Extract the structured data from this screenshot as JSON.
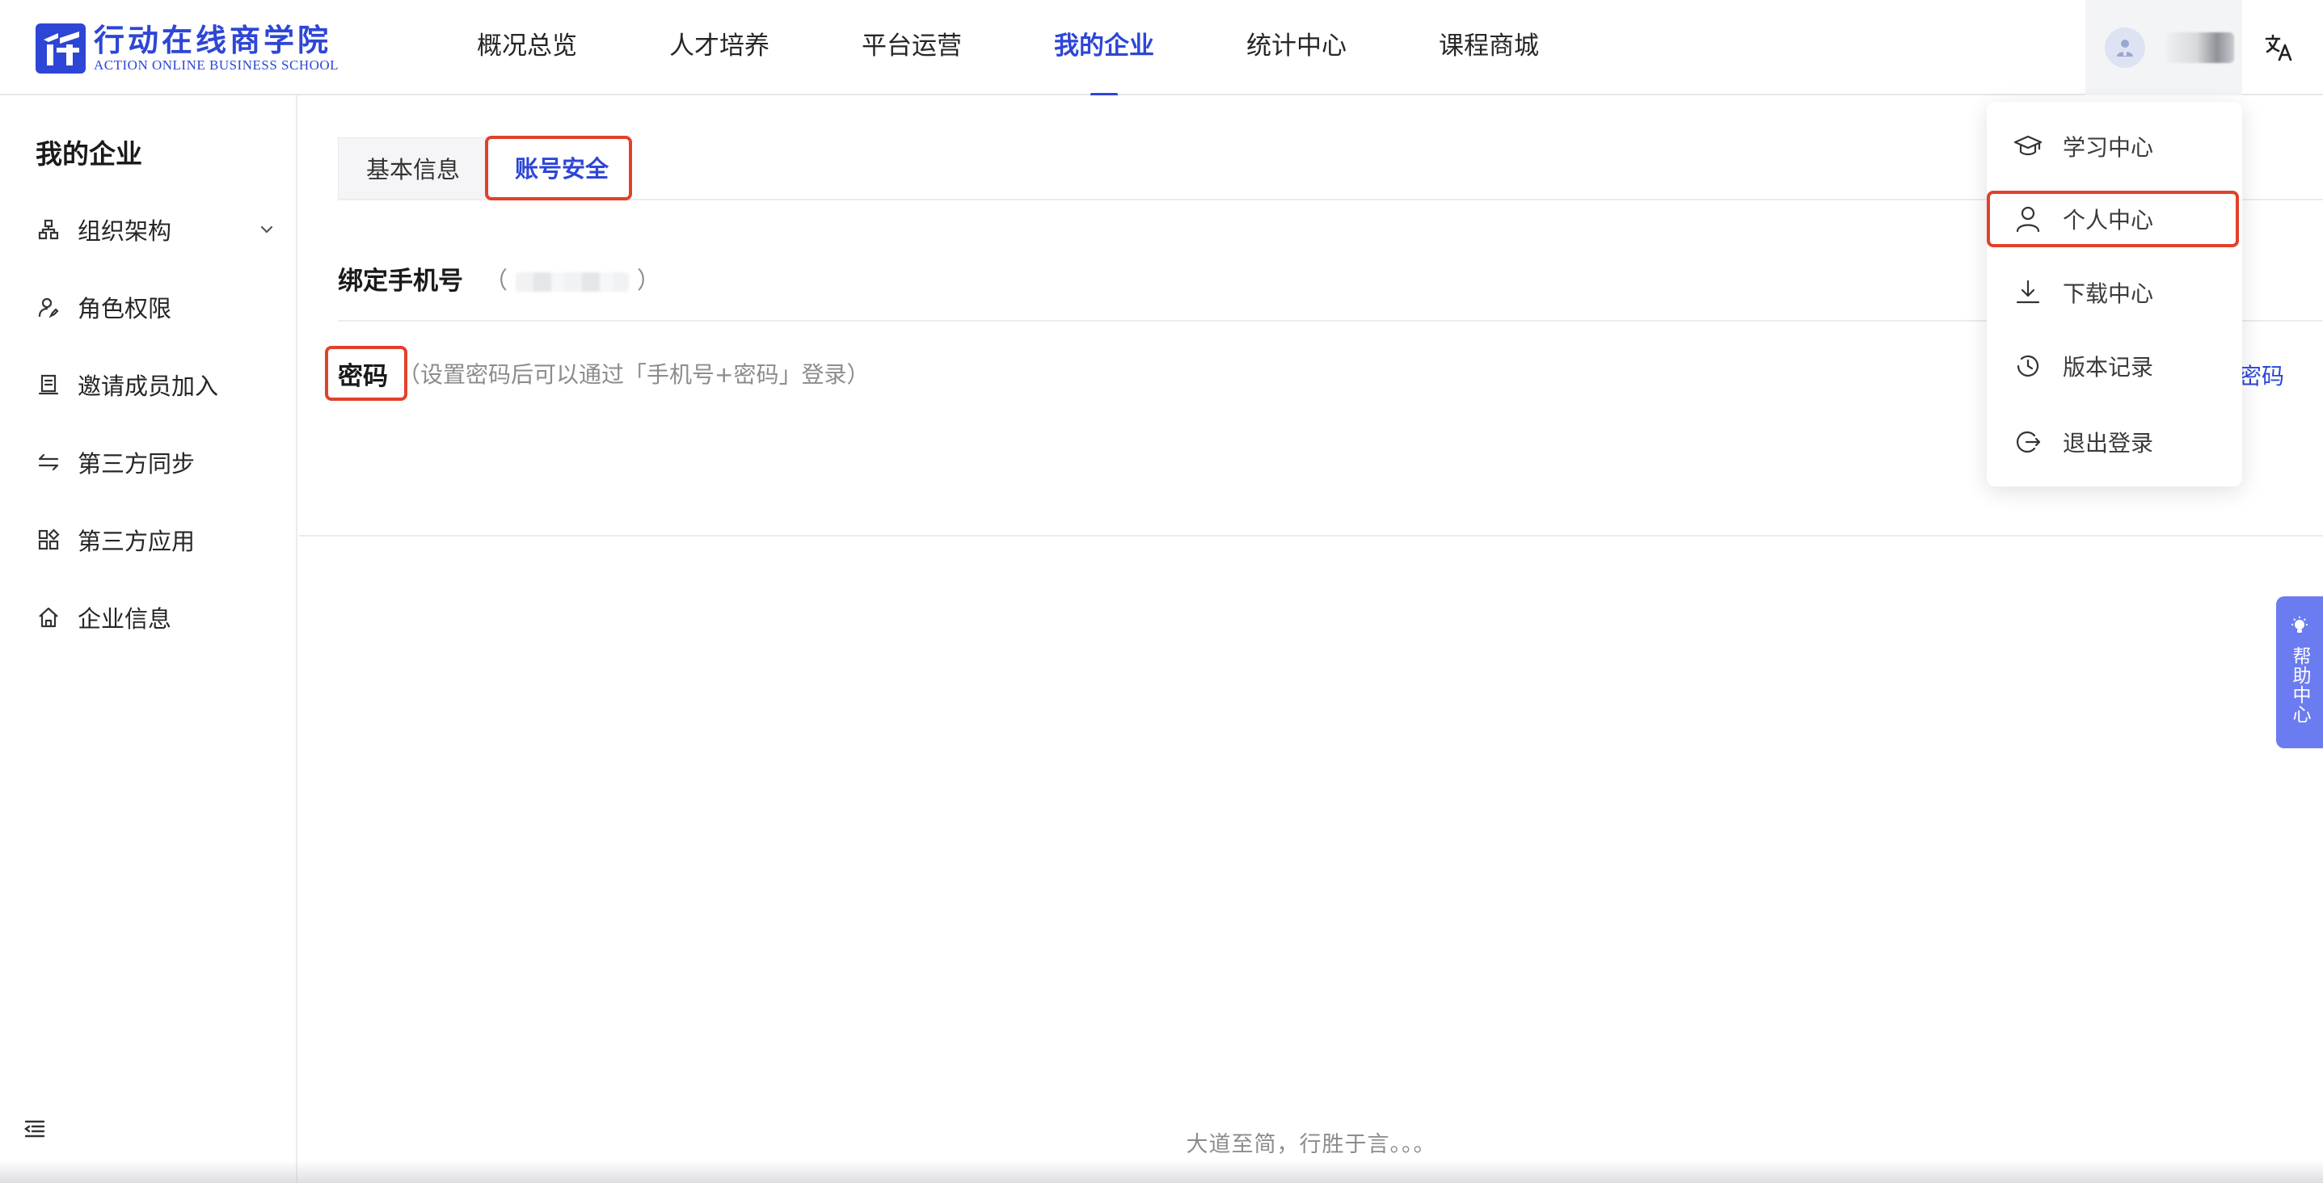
{
  "brand": {
    "name_cn": "行动在线商学院",
    "name_en": "ACTION ONLINE BUSINESS SCHOOL",
    "color": "#2d46d6"
  },
  "nav": {
    "items": [
      {
        "label": "概况总览"
      },
      {
        "label": "人才培养"
      },
      {
        "label": "平台运营"
      },
      {
        "label": "我的企业",
        "active": true
      },
      {
        "label": "统计中心"
      },
      {
        "label": "课程商城"
      }
    ]
  },
  "header": {
    "avatar_icon": "user-avatar-icon",
    "language_icon": "translate-icon"
  },
  "sidebar": {
    "title": "我的企业",
    "items": [
      {
        "label": "组织架构",
        "icon": "org-structure-icon",
        "expandable": true
      },
      {
        "label": "角色权限",
        "icon": "user-role-icon"
      },
      {
        "label": "邀请成员加入",
        "icon": "invite-icon"
      },
      {
        "label": "第三方同步",
        "icon": "sync-icon"
      },
      {
        "label": "第三方应用",
        "icon": "apps-icon"
      },
      {
        "label": "企业信息",
        "icon": "home-icon"
      }
    ],
    "collapse_icon": "collapse-menu-icon"
  },
  "tabs": [
    {
      "label": "基本信息",
      "active": false
    },
    {
      "label": "账号安全",
      "active": true
    }
  ],
  "security": {
    "phone_label": "绑定手机号",
    "phone_paren_open": "（",
    "phone_paren_close": "）",
    "password_label": "密码",
    "password_hint": "（设置密码后可以通过「手机号+密码」登录）",
    "password_action": "密码"
  },
  "footer": {
    "text": "大道至简，行胜于言。。。"
  },
  "dropdown": {
    "items": [
      {
        "label": "学习中心",
        "icon": "graduation-cap-icon"
      },
      {
        "label": "个人中心",
        "icon": "person-icon"
      },
      {
        "label": "下载中心",
        "icon": "download-icon"
      },
      {
        "label": "版本记录",
        "icon": "history-icon"
      },
      {
        "label": "退出登录",
        "icon": "logout-icon"
      }
    ]
  },
  "help": {
    "label": "帮助中心",
    "icon": "lightbulb-icon",
    "color": "#6b7cf0"
  },
  "annotation_color": "#e2402c"
}
